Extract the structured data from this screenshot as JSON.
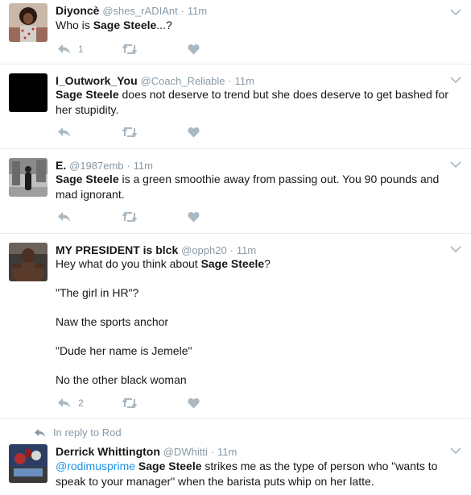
{
  "tweets": [
    {
      "name": "Diyoncè",
      "handle": "@shes_rADIAnt",
      "time": "11m",
      "text_parts": [
        "Who is ",
        "Sage Steele",
        "...?"
      ],
      "reply_count": "1"
    },
    {
      "name": "I_Outwork_You",
      "handle": "@Coach_Reliable",
      "time": "11m",
      "text_parts": [
        "Sage Steele",
        " does not deserve to trend but she does deserve to get bashed for her stupidity."
      ]
    },
    {
      "name": "E.",
      "handle": "@1987emb",
      "time": "11m",
      "text_parts": [
        "Sage Steele",
        " is a green smoothie away from passing out. You 90 pounds and mad ignorant."
      ]
    },
    {
      "name": "MY PRESIDENT is blck",
      "handle": "@opph20",
      "time": "11m",
      "text_parts": [
        "Hey what do you think about ",
        "Sage Steele",
        "?"
      ],
      "paragraphs": [
        "\"The girl in HR\"?",
        "Naw the sports anchor",
        "\"Dude her name is Jemele\"",
        "No the other black woman"
      ],
      "reply_count": "2"
    },
    {
      "reply_to": "In reply to Rod",
      "name": "Derrick Whittington",
      "handle": "@DWhitti",
      "time": "11m",
      "mention": "@rodimusprime",
      "text_parts": [
        "Sage Steele",
        " strikes me as the type of person who \"wants to speak to your manager\" when the barista puts whip on her latte."
      ]
    }
  ],
  "ui": {
    "separator": "·"
  },
  "icons": {
    "reply": "reply-icon",
    "retweet": "retweet-icon",
    "like": "heart-icon",
    "more": "chevron-down-icon"
  },
  "colors": {
    "text": "#14171a",
    "muted": "#8899a6",
    "icon": "#aab8c2",
    "link": "#1b95e0",
    "divider": "#e6ecf0"
  }
}
